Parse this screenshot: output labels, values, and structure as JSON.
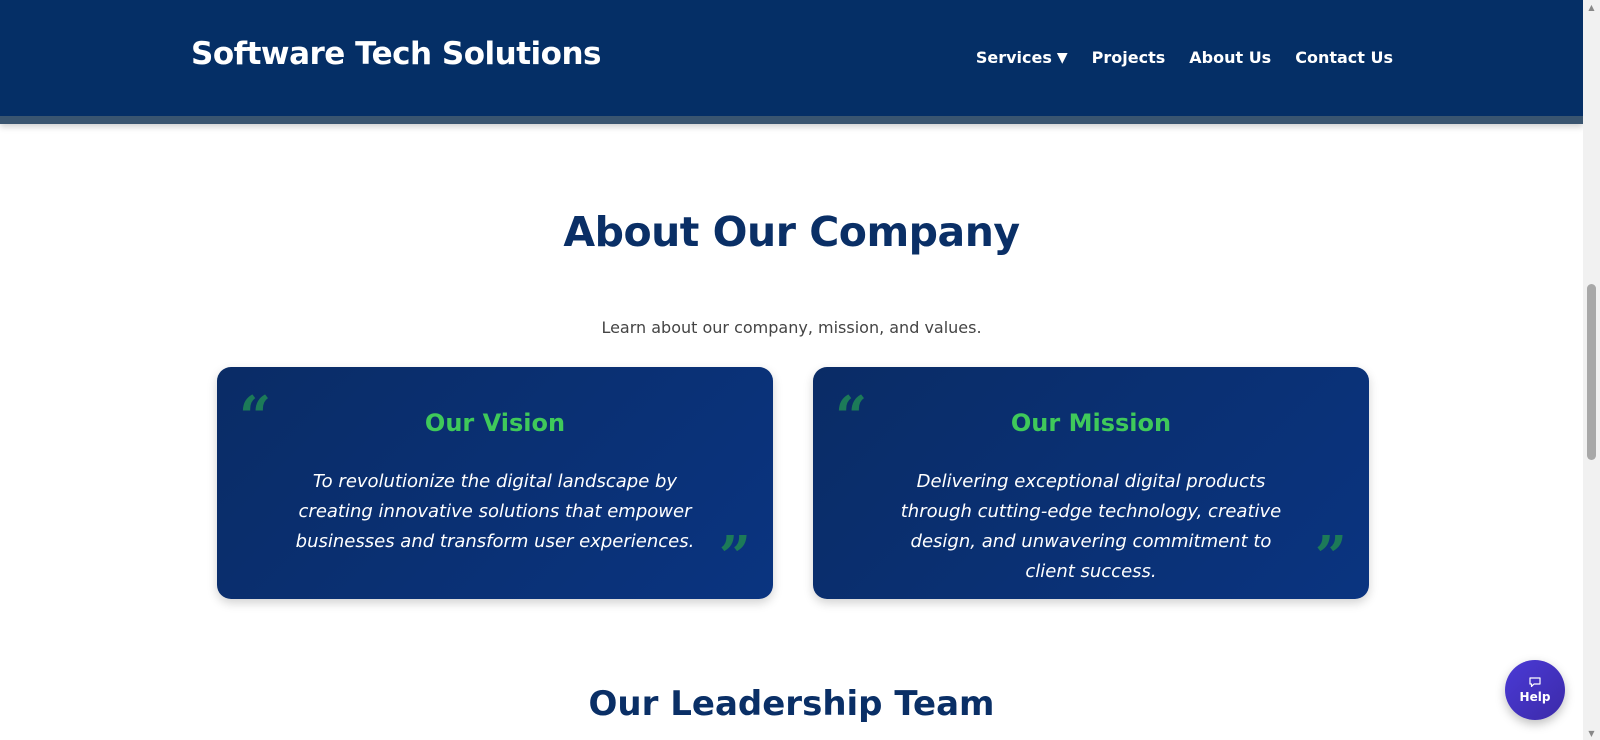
{
  "header": {
    "brand": "Software Tech Solutions",
    "nav": [
      {
        "label": "Services",
        "has_dropdown": true,
        "caret": "▼"
      },
      {
        "label": "Projects"
      },
      {
        "label": "About Us"
      },
      {
        "label": "Contact Us"
      }
    ]
  },
  "about": {
    "title": "About Our Company",
    "subtitle": "Learn about our company, mission, and values.",
    "cards": [
      {
        "title": "Our Vision",
        "text": "To revolutionize the digital landscape by creating innovative solutions that empower businesses and transform user experiences.",
        "quote_open": "“",
        "quote_close": "”"
      },
      {
        "title": "Our Mission",
        "text": "Delivering exceptional digital products through cutting-edge technology, creative design, and unwavering commitment to client success.",
        "quote_open": "“",
        "quote_close": "”"
      }
    ]
  },
  "leadership": {
    "title": "Our Leadership Team"
  },
  "help": {
    "label": "Help",
    "icon": "chat-icon"
  },
  "colors": {
    "header_bg": "#052f66",
    "accent_green": "#3fc95a",
    "title_navy": "#0a2f66",
    "help_purple": "#4a3ad6"
  }
}
